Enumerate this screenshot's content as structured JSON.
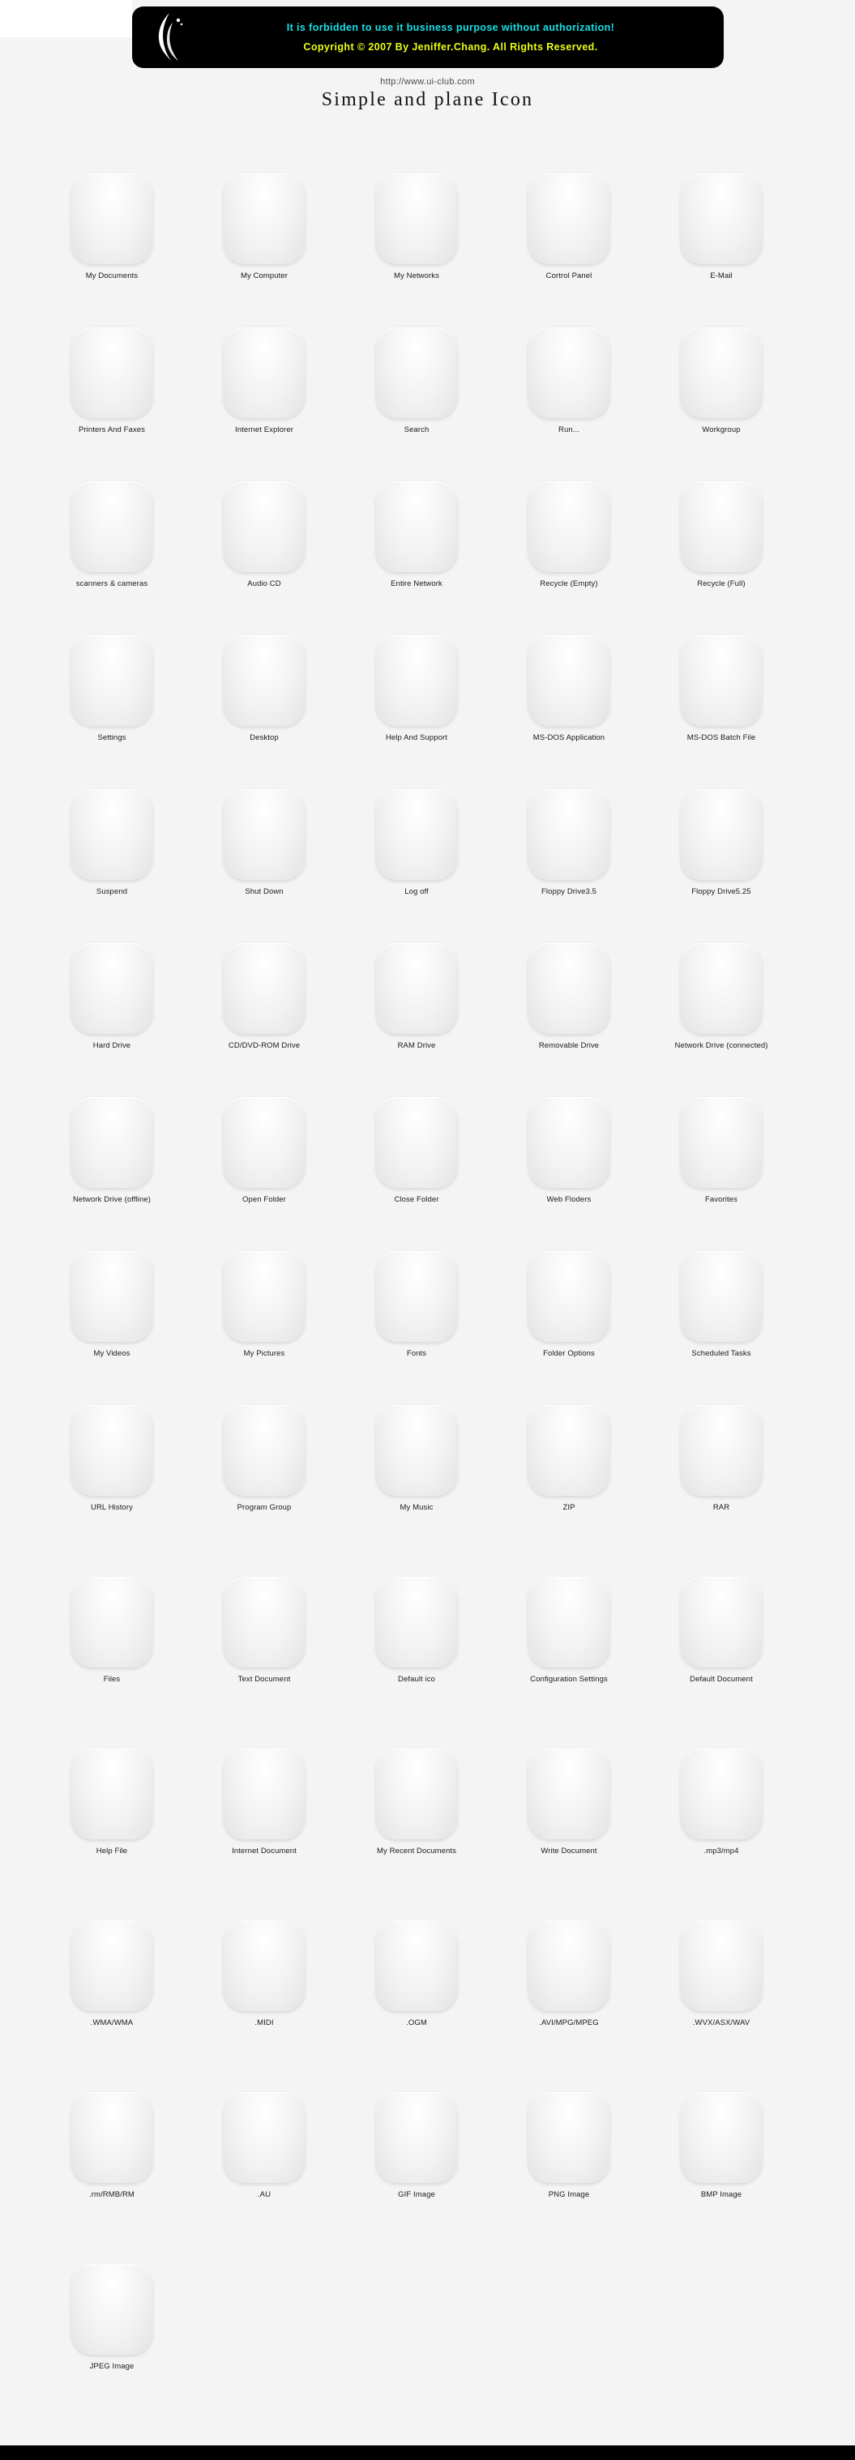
{
  "banner": {
    "line1": "It is forbidden to use it business purpose without authorization!",
    "line2": "Copyright © 2007 By Jeniffer.Chang. All Rights Reserved.",
    "logo_icon": "flame-logo-icon"
  },
  "header": {
    "url": "http://www.ui-club.com",
    "title": "Simple and plane Icon"
  },
  "colors": {
    "background": "#f4f4f4",
    "banner_background": "#000000",
    "banner_line1": "#18e0e8",
    "banner_line2": "#e8ff12",
    "accent_cyan": "#21c9d9",
    "accent_magenta": "#d6189c",
    "accent_green": "#8cc63f",
    "accent_orange": "#f07d1a",
    "label_text": "#1a1a1a",
    "footer": "#000000"
  },
  "grid": {
    "columns": 5,
    "rows": [
      {
        "cells": [
          {
            "label": "My Documents",
            "icon": "my-documents-icon"
          },
          {
            "label": "My Computer",
            "icon": "my-computer-icon"
          },
          {
            "label": "My Networks",
            "icon": "my-networks-globe-icon"
          },
          {
            "label": "Cortrol Panel",
            "icon": "control-panel-icon"
          },
          {
            "label": "E-Mail",
            "icon": "email-envelope-icon"
          }
        ]
      },
      {
        "cells": [
          {
            "label": "Printers And Faxes",
            "icon": "printer-fax-icon"
          },
          {
            "label": "Internet Explorer",
            "icon": "internet-explorer-e-icon"
          },
          {
            "label": "Search",
            "icon": "search-magnifier-globe-icon"
          },
          {
            "label": "Run...",
            "icon": "run-dialog-icon"
          },
          {
            "label": "Workgroup",
            "icon": "workgroup-nodes-icon"
          }
        ]
      },
      {
        "cells": [
          {
            "label": "scanners & cameras",
            "icon": "scanner-camera-lens-icon"
          },
          {
            "label": "Audio CD",
            "icon": "audio-cd-disc-icon"
          },
          {
            "label": "Entire Network",
            "icon": "entire-network-icon"
          },
          {
            "label": "Recycle (Empty)",
            "icon": "recycle-empty-icon"
          },
          {
            "label": "Recycle (Full)",
            "icon": "recycle-full-icon"
          }
        ]
      },
      {
        "cells": [
          {
            "label": "Settings",
            "icon": "settings-gear-icon"
          },
          {
            "label": "Desktop",
            "icon": "desktop-monitor-icon"
          },
          {
            "label": "Help And Support",
            "icon": "help-support-cross-icon"
          },
          {
            "label": "MS-DOS Application",
            "icon": "ms-dos-application-icon"
          },
          {
            "label": "MS-DOS Batch File",
            "icon": "ms-dos-batch-file-icon"
          }
        ]
      },
      {
        "cells": [
          {
            "label": "Suspend",
            "icon": "suspend-power-icon"
          },
          {
            "label": "Shut Down",
            "icon": "shut-down-x-icon"
          },
          {
            "label": "Log off",
            "icon": "log-off-dots-icon"
          },
          {
            "label": "Floppy Drive3.5",
            "icon": "floppy-drive-35-icon"
          },
          {
            "label": "Floppy Drive5.25",
            "icon": "floppy-drive-525-icon"
          }
        ]
      },
      {
        "cells": [
          {
            "label": "Hard Drive",
            "icon": "hard-drive-icon"
          },
          {
            "label": "CD/DVD-ROM Drive",
            "icon": "cd-dvd-rom-drive-icon"
          },
          {
            "label": "RAM Drive",
            "icon": "ram-drive-icon"
          },
          {
            "label": "Removable Drive",
            "icon": "removable-usb-drive-icon"
          },
          {
            "label": "Network Drive (connected)",
            "icon": "network-drive-connected-icon"
          }
        ]
      },
      {
        "cells": [
          {
            "label": "Network Drive (offline)",
            "icon": "network-drive-offline-icon"
          },
          {
            "label": "Open Folder",
            "icon": "open-folder-icon"
          },
          {
            "label": "Close Folder",
            "icon": "close-folder-icon"
          },
          {
            "label": "Web Floders",
            "icon": "web-folders-globe-icon"
          },
          {
            "label": "Favorites",
            "icon": "favorites-icon"
          }
        ]
      },
      {
        "cells": [
          {
            "label": "My Videos",
            "icon": "my-videos-play-icon"
          },
          {
            "label": "My Pictures",
            "icon": "my-pictures-icon"
          },
          {
            "label": "Fonts",
            "icon": "fonts-f-icon"
          },
          {
            "label": "Folder Options",
            "icon": "folder-options-check-icon"
          },
          {
            "label": "Scheduled Tasks",
            "icon": "scheduled-tasks-clock-icon"
          }
        ]
      },
      {
        "cells": [
          {
            "label": "URL History",
            "icon": "url-history-refresh-icon"
          },
          {
            "label": "Program Group",
            "icon": "program-group-icon"
          },
          {
            "label": "My Music",
            "icon": "my-music-note-icon"
          },
          {
            "label": "ZIP",
            "icon": "zip-archive-icon"
          },
          {
            "label": "RAR",
            "icon": "rar-archive-icon"
          }
        ]
      },
      {
        "cells": [
          {
            "label": "Files",
            "icon": "files-icon"
          },
          {
            "label": "Text Document",
            "icon": "text-document-icon"
          },
          {
            "label": "Default ico",
            "icon": "default-ico-icon"
          },
          {
            "label": "Configuration Settings",
            "icon": "configuration-settings-gear-icon"
          },
          {
            "label": "Default Document",
            "icon": "default-document-icon"
          }
        ]
      },
      {
        "cells": [
          {
            "label": "Help File",
            "icon": "help-file-cross-icon"
          },
          {
            "label": "Internet Document",
            "icon": "internet-document-globe-icon"
          },
          {
            "label": "My Recent  Documents",
            "icon": "my-recent-documents-clock-icon"
          },
          {
            "label": "Write Document",
            "icon": "write-document-pen-icon"
          },
          {
            "label": ".mp3/mp4",
            "icon": "mp3-mp4-note-icon"
          }
        ]
      },
      {
        "cells": [
          {
            "label": ".WMA/WMA",
            "icon": "wma-note-icon"
          },
          {
            "label": ".MIDI",
            "icon": "midi-note-icon"
          },
          {
            "label": ".OGM",
            "icon": "ogm-note-icon"
          },
          {
            "label": ".AVI/MPG/MPEG",
            "icon": "avi-mpg-play-icon"
          },
          {
            "label": ".WVX/ASX/WAV",
            "icon": "wvx-asx-wav-play-icon"
          }
        ]
      },
      {
        "cells": [
          {
            "label": ".rm/RMB/RM",
            "icon": "rm-play-icon"
          },
          {
            "label": ".AU",
            "icon": "au-play-icon"
          },
          {
            "label": "GIF Image",
            "icon": "gif-image-icon"
          },
          {
            "label": "PNG Image",
            "icon": "png-image-icon"
          },
          {
            "label": "BMP Image",
            "icon": "bmp-image-icon"
          }
        ]
      },
      {
        "cells": [
          {
            "label": "JPEG Image",
            "icon": "jpeg-image-icon"
          }
        ]
      }
    ]
  }
}
